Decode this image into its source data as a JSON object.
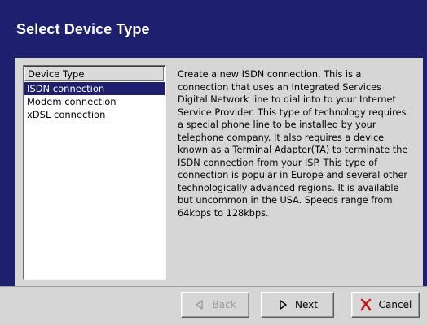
{
  "window": {
    "title": "Select Device Type"
  },
  "device_list": {
    "header": "Device Type",
    "items": [
      {
        "label": "ISDN connection",
        "selected": true
      },
      {
        "label": "Modem connection",
        "selected": false
      },
      {
        "label": "xDSL connection",
        "selected": false
      }
    ]
  },
  "description": {
    "text": "Create a new ISDN connection. This is a connection that uses an Integrated Services Digital Network line to dial into to your Internet Service Provider. This type of technology requires a special phone line to be installed by your telephone company. It also requires a device known as a Terminal Adapter(TA) to terminate the ISDN connection from your ISP. This type of connection is popular in Europe and several other technologically advanced regions. It is available but uncommon in the USA. Speeds range from 64kbps to 128kbps."
  },
  "buttons": {
    "back": {
      "label": "Back",
      "icon": "back-arrow-icon",
      "enabled": false
    },
    "next": {
      "label": "Next",
      "icon": "next-arrow-icon",
      "enabled": true
    },
    "cancel": {
      "label": "Cancel",
      "icon": "cancel-x-icon",
      "enabled": true
    }
  },
  "colors": {
    "banner": "#1e1f6e",
    "selection": "#1e1f6e",
    "cancel_icon": "#cc1f1f"
  }
}
